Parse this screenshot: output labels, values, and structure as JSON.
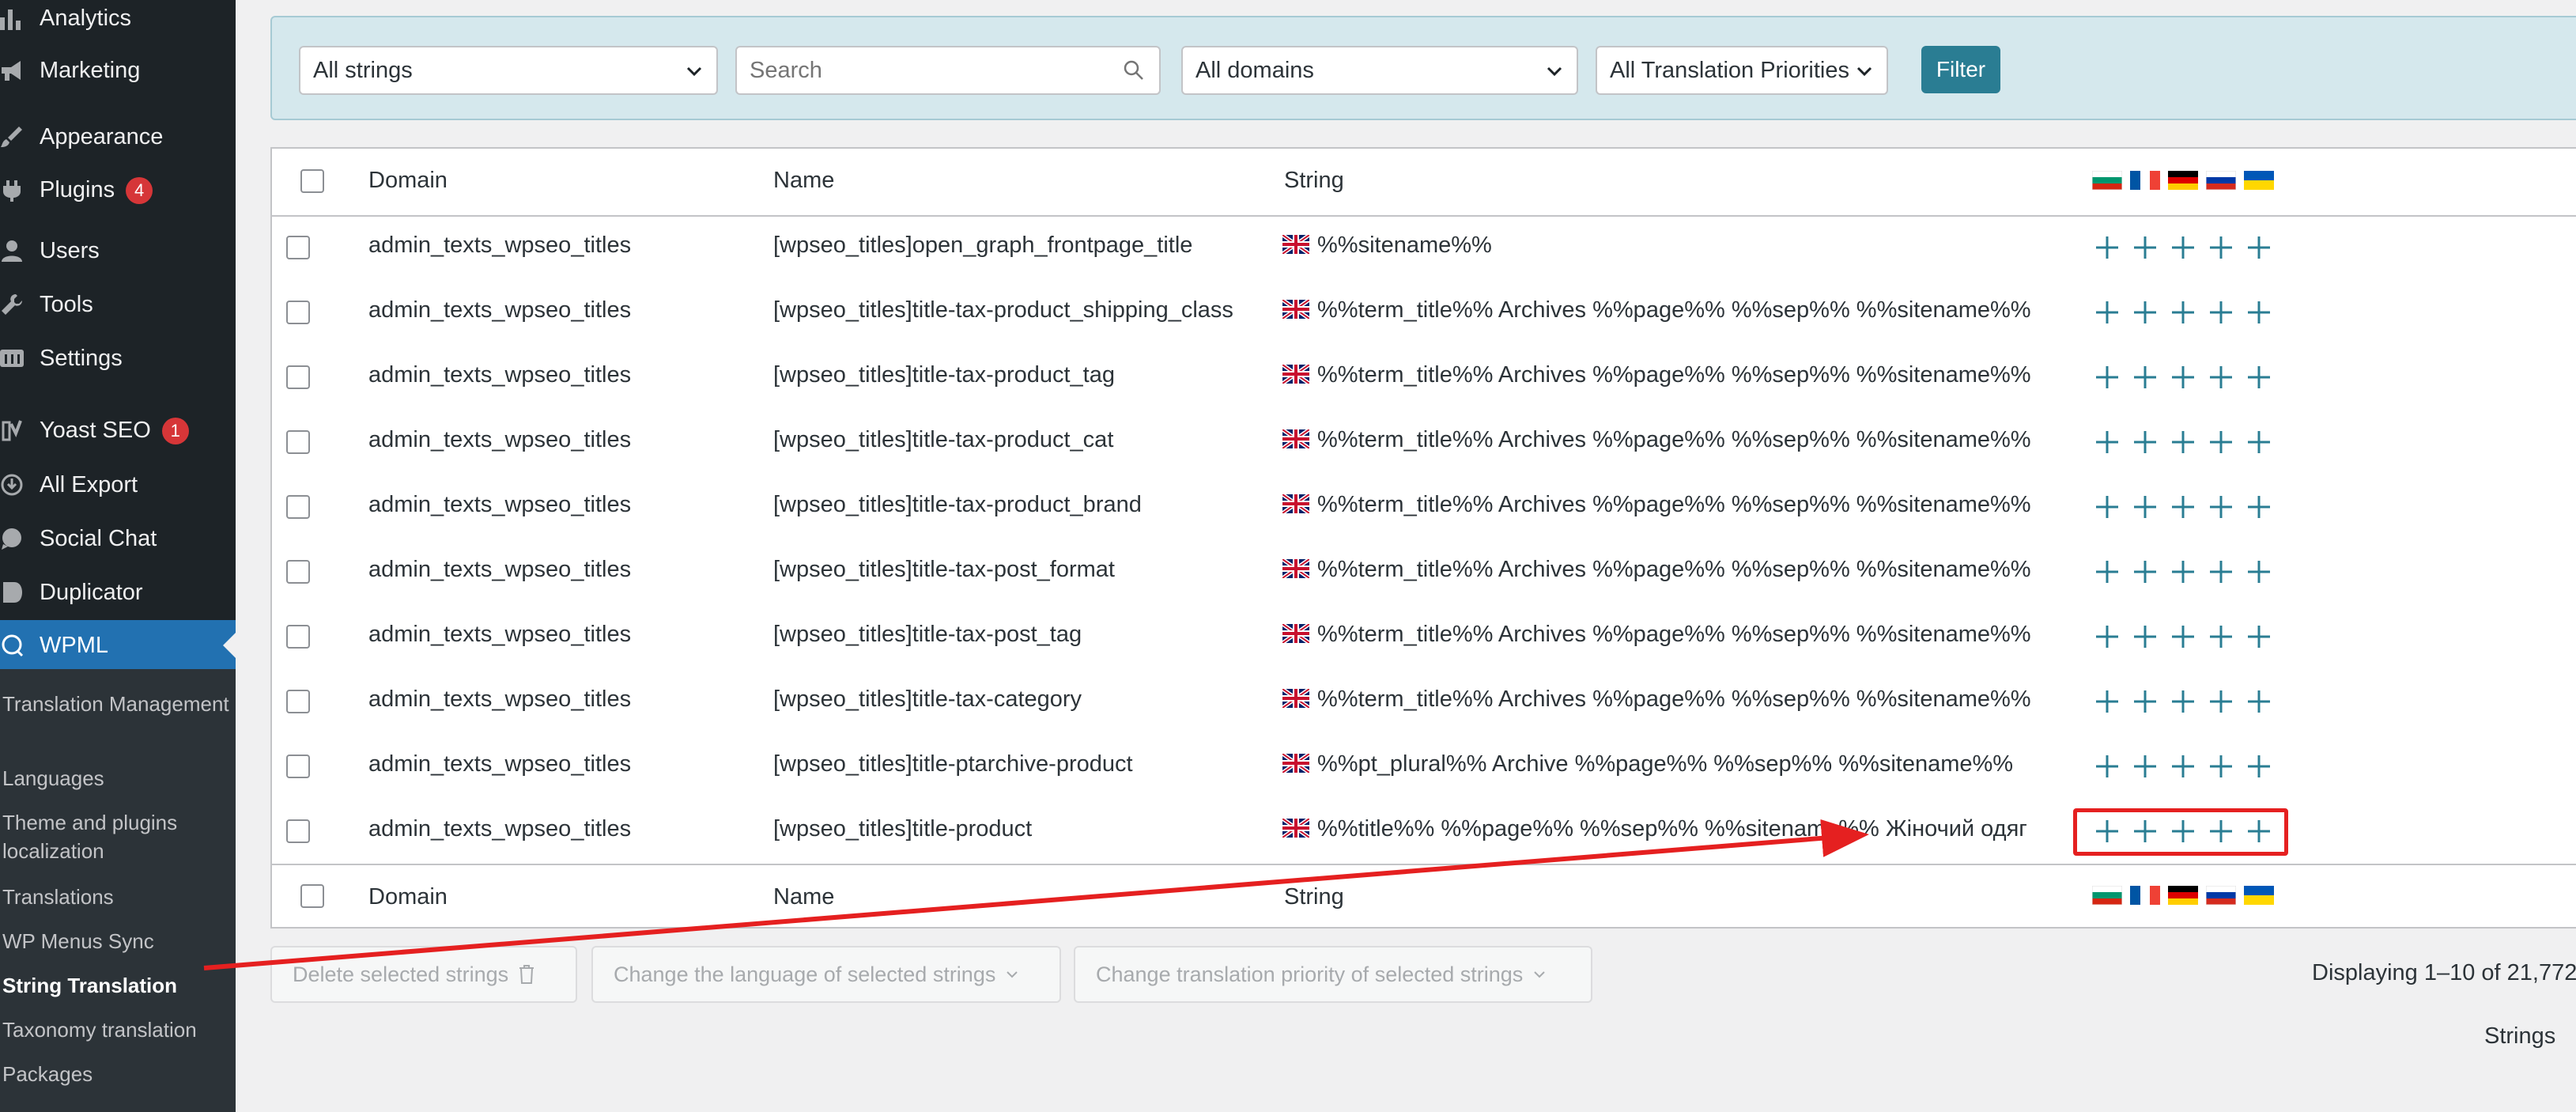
{
  "sidebar": {
    "items": [
      {
        "label": "Analytics",
        "icon": "bar-chart-icon"
      },
      {
        "label": "Marketing",
        "icon": "megaphone-icon"
      },
      {
        "label": "Appearance",
        "icon": "brush-icon"
      },
      {
        "label": "Plugins",
        "icon": "plugin-icon",
        "badge": "4"
      },
      {
        "label": "Users",
        "icon": "user-icon"
      },
      {
        "label": "Tools",
        "icon": "wrench-icon"
      },
      {
        "label": "Settings",
        "icon": "settings-icon"
      },
      {
        "label": "Yoast SEO",
        "icon": "yoast-icon",
        "badge": "1"
      },
      {
        "label": "All Export",
        "icon": "export-icon"
      },
      {
        "label": "Social Chat",
        "icon": "chat-icon"
      },
      {
        "label": "Duplicator",
        "icon": "duplicator-icon"
      },
      {
        "label": "WPML",
        "icon": "wpml-icon",
        "active": true
      }
    ],
    "submenu": [
      "Translation Management",
      "Languages",
      "Theme and plugins localization",
      "Translations",
      "WP Menus Sync",
      "String Translation",
      "Taxonomy translation",
      "Packages"
    ],
    "current_submenu": "String Translation"
  },
  "filters": {
    "strings_select": "All strings",
    "search_placeholder": "Search",
    "domains_select": "All domains",
    "priorities_select": "All Translation Priorities",
    "filter_button": "Filter"
  },
  "table": {
    "columns": {
      "domain": "Domain",
      "name": "Name",
      "string": "String"
    },
    "languages": [
      "bulgarian-flag",
      "french-flag",
      "german-flag",
      "russian-flag",
      "ukrainian-flag"
    ],
    "rows": [
      {
        "domain": "admin_texts_wpseo_titles",
        "name": "[wpseo_titles]open_graph_frontpage_title",
        "string": "%%sitename%%"
      },
      {
        "domain": "admin_texts_wpseo_titles",
        "name": "[wpseo_titles]title-tax-product_shipping_class",
        "string": "%%term_title%% Archives %%page%% %%sep%% %%sitename%%"
      },
      {
        "domain": "admin_texts_wpseo_titles",
        "name": "[wpseo_titles]title-tax-product_tag",
        "string": "%%term_title%% Archives %%page%% %%sep%% %%sitename%%"
      },
      {
        "domain": "admin_texts_wpseo_titles",
        "name": "[wpseo_titles]title-tax-product_cat",
        "string": "%%term_title%% Archives %%page%% %%sep%% %%sitename%%"
      },
      {
        "domain": "admin_texts_wpseo_titles",
        "name": "[wpseo_titles]title-tax-product_brand",
        "string": "%%term_title%% Archives %%page%% %%sep%% %%sitename%%"
      },
      {
        "domain": "admin_texts_wpseo_titles",
        "name": "[wpseo_titles]title-tax-post_format",
        "string": "%%term_title%% Archives %%page%% %%sep%% %%sitename%%"
      },
      {
        "domain": "admin_texts_wpseo_titles",
        "name": "[wpseo_titles]title-tax-post_tag",
        "string": "%%term_title%% Archives %%page%% %%sep%% %%sitename%%"
      },
      {
        "domain": "admin_texts_wpseo_titles",
        "name": "[wpseo_titles]title-tax-category",
        "string": "%%term_title%% Archives %%page%% %%sep%% %%sitename%%"
      },
      {
        "domain": "admin_texts_wpseo_titles",
        "name": "[wpseo_titles]title-ptarchive-product",
        "string": "%%pt_plural%% Archive %%page%% %%sep%% %%sitename%%"
      },
      {
        "domain": "admin_texts_wpseo_titles",
        "name": "[wpseo_titles]title-product",
        "string": "%%title%% %%page%% %%sep%% %%sitename%% Жіночий одяг"
      }
    ]
  },
  "bulk_actions": {
    "delete": "Delete selected strings",
    "change_language": "Change the language of selected strings",
    "change_priority": "Change translation priority of selected strings"
  },
  "pagination": {
    "displaying": "Displaying 1–10 of 21,772"
  },
  "strings_label": "Strings",
  "colors": {
    "sidebar_bg": "#1d2327",
    "submenu_bg": "#2c3338",
    "active_menu": "#2271b1",
    "filter_panel": "#d5e8ed",
    "filter_button": "#2a7d93",
    "plus_icon": "#2a7d93",
    "annotation": "#e52020"
  }
}
